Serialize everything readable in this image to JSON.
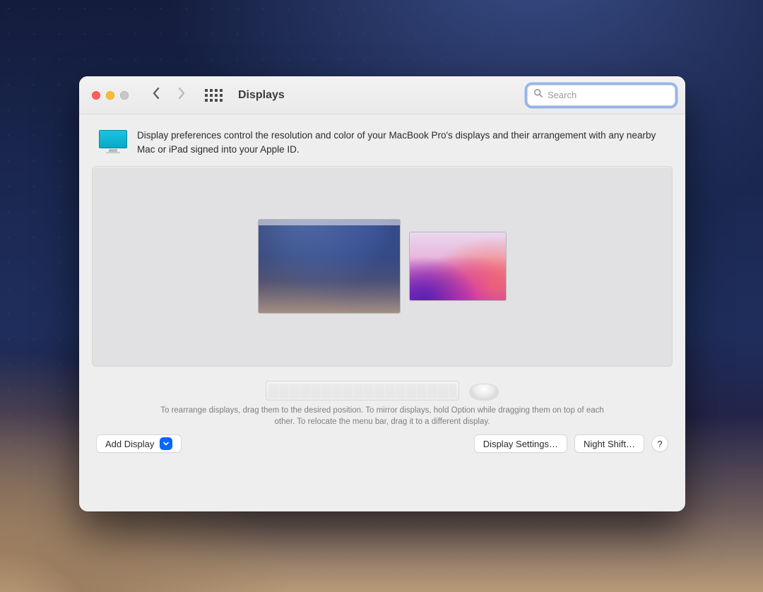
{
  "window": {
    "title": "Displays"
  },
  "search": {
    "placeholder": "Search",
    "value": ""
  },
  "intro": {
    "text": "Display preferences control the resolution and color of your MacBook Pro's displays and their arrangement with any nearby Mac or iPad signed into your Apple ID."
  },
  "hint": {
    "text": "To rearrange displays, drag them to the desired position. To mirror displays, hold Option while dragging them on top of each other. To relocate the menu bar, drag it to a different display."
  },
  "buttons": {
    "add_display": "Add Display",
    "display_settings": "Display Settings…",
    "night_shift": "Night Shift…",
    "help": "?"
  }
}
